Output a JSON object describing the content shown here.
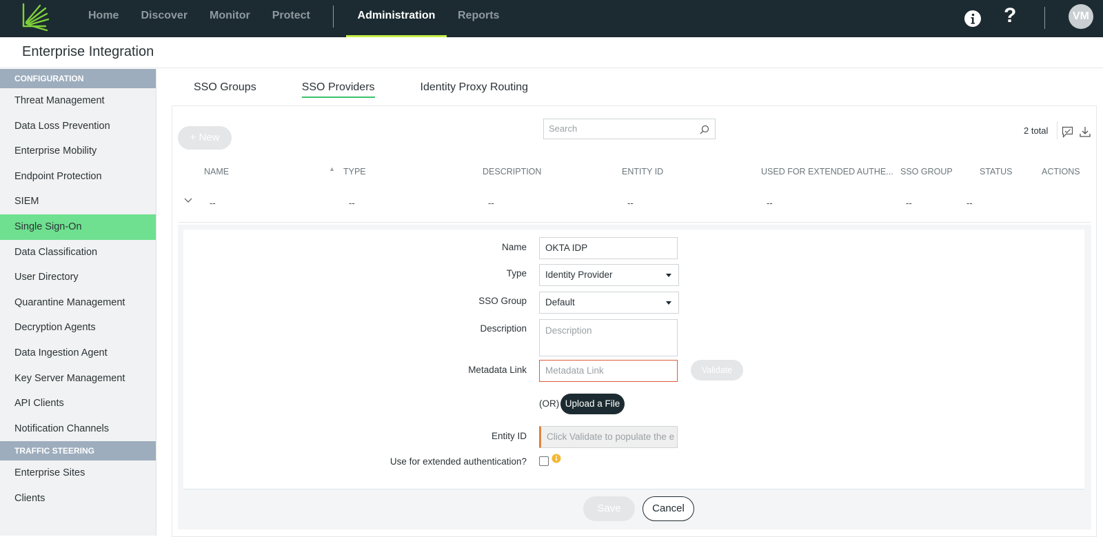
{
  "topnav": {
    "items": [
      "Home",
      "Discover",
      "Monitor",
      "Protect"
    ],
    "active": "Administration",
    "reports": "Reports",
    "avatar_initials": "VM",
    "help_glyph": "?"
  },
  "page": {
    "title": "Enterprise Integration"
  },
  "sidebar": {
    "section_config": "CONFIGURATION",
    "items": [
      "Threat Management",
      "Data Loss Prevention",
      "Enterprise Mobility",
      "Endpoint Protection",
      "SIEM",
      "Single Sign-On",
      "Data Classification",
      "User Directory",
      "Quarantine Management",
      "Decryption Agents",
      "Data Ingestion Agent",
      "Key Server Management",
      "API Clients",
      "Notification Channels"
    ],
    "active_item": "Single Sign-On",
    "section_traffic": "TRAFFIC STEERING",
    "traffic_items": [
      "Enterprise Sites",
      "Clients"
    ]
  },
  "tabs": [
    "SSO Groups",
    "SSO Providers",
    "Identity Proxy Routing"
  ],
  "toolbar": {
    "new_label": "+ New",
    "search_placeholder": "Search",
    "total": "2 total"
  },
  "table": {
    "headers": [
      "NAME",
      "TYPE",
      "DESCRIPTION",
      "ENTITY ID",
      "USED FOR EXTENDED AUTHE...",
      "SSO GROUP",
      "STATUS",
      "ACTIONS"
    ],
    "row": [
      "--",
      "--",
      "--",
      "--",
      "--",
      "--",
      "--"
    ]
  },
  "form": {
    "name_label": "Name",
    "name_value": "OKTA IDP",
    "type_label": "Type",
    "type_value": "Identity Provider",
    "group_label": "SSO Group",
    "group_value": "Default",
    "desc_label": "Description",
    "desc_placeholder": "Description",
    "metadata_label": "Metadata Link",
    "metadata_placeholder": "Metadata Link",
    "validate_label": "Validate",
    "or_text": "(OR)",
    "upload_label": "Upload a File",
    "entity_label": "Entity ID",
    "entity_placeholder": "Click Validate to populate the e",
    "extended_label": "Use for extended authentication?",
    "save_label": "Save",
    "cancel_label": "Cancel"
  },
  "colors": {
    "topbar": "#1c2b31",
    "accent_green": "#6ee08f",
    "nav_underline": "#c8f04a",
    "error_red": "#e0593c"
  }
}
